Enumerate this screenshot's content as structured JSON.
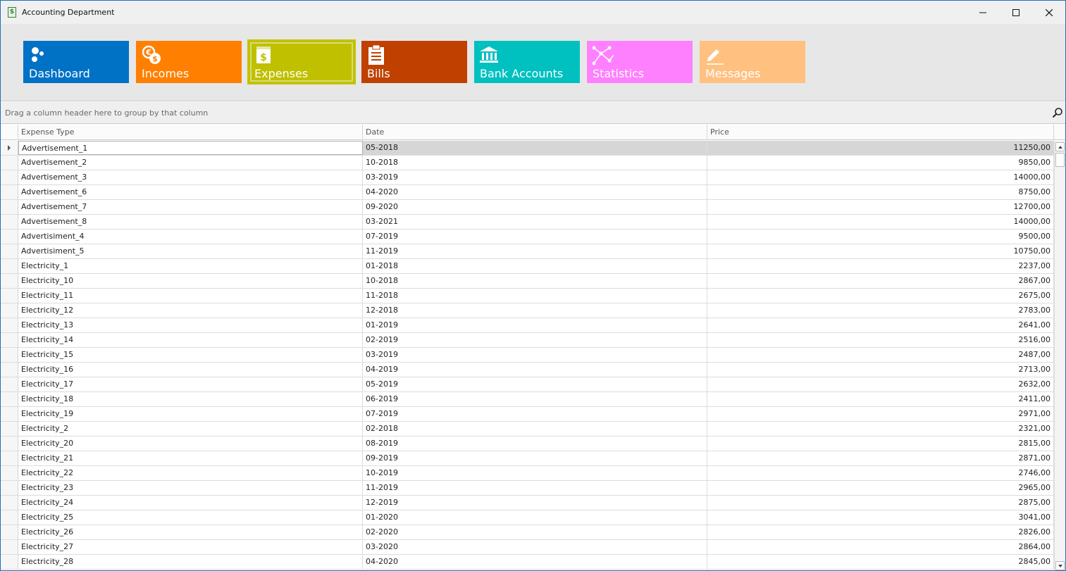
{
  "window": {
    "title": "Accounting Department",
    "app_icon_glyph": "$"
  },
  "ribbon": {
    "tiles": [
      {
        "label": "Dashboard",
        "color": "#0072c6",
        "icon": "dashboard-icon"
      },
      {
        "label": "Incomes",
        "color": "#ff8000",
        "icon": "currency-icon"
      },
      {
        "label": "Expenses",
        "color": "#c0c000",
        "icon": "expense-book-icon",
        "selected": true
      },
      {
        "label": "Bills",
        "color": "#c04000",
        "icon": "clipboard-icon"
      },
      {
        "label": "Bank Accounts",
        "color": "#00c0c0",
        "icon": "bank-icon"
      },
      {
        "label": "Statistics",
        "color": "#ff80ff",
        "icon": "network-chart-icon"
      },
      {
        "label": "Messages",
        "color": "#ffc080",
        "icon": "pencil-icon"
      }
    ]
  },
  "group_panel": {
    "text": "Drag a column header here to group by that column"
  },
  "grid": {
    "columns": [
      "Expense Type",
      "Date",
      "Price"
    ],
    "rows": [
      {
        "type": "Advertisement_1",
        "date": "05-2018",
        "price": "11250,00"
      },
      {
        "type": "Advertisement_2",
        "date": "10-2018",
        "price": "9850,00"
      },
      {
        "type": "Advertisement_3",
        "date": "03-2019",
        "price": "14000,00"
      },
      {
        "type": "Advertisement_6",
        "date": "04-2020",
        "price": "8750,00"
      },
      {
        "type": "Advertisement_7",
        "date": "09-2020",
        "price": "12700,00"
      },
      {
        "type": "Advertisement_8",
        "date": "03-2021",
        "price": "14000,00"
      },
      {
        "type": "Advertisiment_4",
        "date": "07-2019",
        "price": "9500,00"
      },
      {
        "type": "Advertisiment_5",
        "date": "11-2019",
        "price": "10750,00"
      },
      {
        "type": "Electricity_1",
        "date": "01-2018",
        "price": "2237,00"
      },
      {
        "type": "Electricity_10",
        "date": "10-2018",
        "price": "2867,00"
      },
      {
        "type": "Electricity_11",
        "date": "11-2018",
        "price": "2675,00"
      },
      {
        "type": "Electricity_12",
        "date": "12-2018",
        "price": "2783,00"
      },
      {
        "type": "Electricity_13",
        "date": "01-2019",
        "price": "2641,00"
      },
      {
        "type": "Electricity_14",
        "date": "02-2019",
        "price": "2516,00"
      },
      {
        "type": "Electricity_15",
        "date": "03-2019",
        "price": "2487,00"
      },
      {
        "type": "Electricity_16",
        "date": "04-2019",
        "price": "2713,00"
      },
      {
        "type": "Electricity_17",
        "date": "05-2019",
        "price": "2632,00"
      },
      {
        "type": "Electricity_18",
        "date": "06-2019",
        "price": "2411,00"
      },
      {
        "type": "Electricity_19",
        "date": "07-2019",
        "price": "2971,00"
      },
      {
        "type": "Electricity_2",
        "date": "02-2018",
        "price": "2321,00"
      },
      {
        "type": "Electricity_20",
        "date": "08-2019",
        "price": "2815,00"
      },
      {
        "type": "Electricity_21",
        "date": "09-2019",
        "price": "2871,00"
      },
      {
        "type": "Electricity_22",
        "date": "10-2019",
        "price": "2746,00"
      },
      {
        "type": "Electricity_23",
        "date": "11-2019",
        "price": "2965,00"
      },
      {
        "type": "Electricity_24",
        "date": "12-2019",
        "price": "2875,00"
      },
      {
        "type": "Electricity_25",
        "date": "01-2020",
        "price": "3041,00"
      },
      {
        "type": "Electricity_26",
        "date": "02-2020",
        "price": "2826,00"
      },
      {
        "type": "Electricity_27",
        "date": "03-2020",
        "price": "2864,00"
      },
      {
        "type": "Electricity_28",
        "date": "04-2020",
        "price": "2845,00"
      }
    ]
  }
}
